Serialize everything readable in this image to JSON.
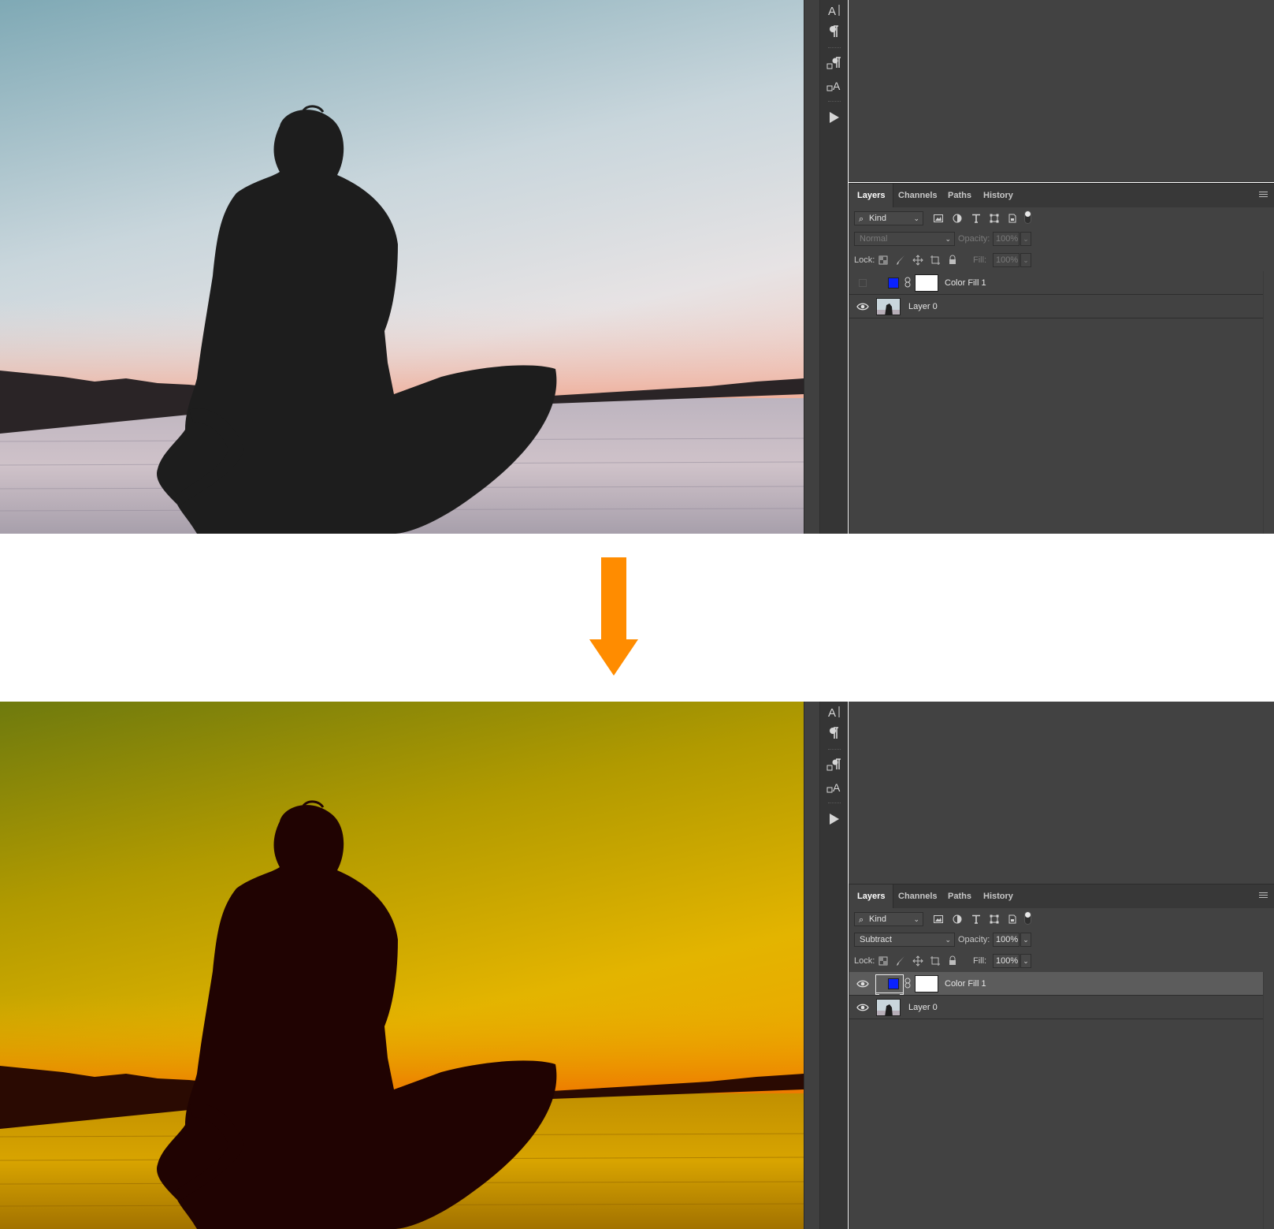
{
  "colors": {
    "arrow": "#ff8c00",
    "panel_bg": "#424242",
    "fill_swatch": "#0a22ff"
  },
  "icons": {
    "toolstrip": [
      "character-icon",
      "paragraph-icon",
      "paragraph-styles-icon",
      "character-styles-icon",
      "play-icon"
    ],
    "filters": [
      "image-filter-icon",
      "adjustment-filter-icon",
      "type-filter-icon",
      "shape-filter-icon",
      "smart-object-filter-icon"
    ],
    "locks": [
      "lock-transparent-icon",
      "lock-paint-icon",
      "lock-position-icon",
      "lock-artboard-icon",
      "lock-all-icon"
    ]
  },
  "before": {
    "tabs": [
      "Layers",
      "Channels",
      "Paths",
      "History"
    ],
    "active_tab": "Layers",
    "kind_filter": "Kind",
    "blend_mode": "Normal",
    "opacity_label": "Opacity:",
    "opacity_value": "100%",
    "lock_label": "Lock:",
    "fill_label": "Fill:",
    "fill_value": "100%",
    "layers": [
      {
        "name": "Color Fill 1",
        "visible": false,
        "selected": false
      },
      {
        "name": "Layer 0",
        "visible": true,
        "selected": false
      }
    ]
  },
  "after": {
    "tabs": [
      "Layers",
      "Channels",
      "Paths",
      "History"
    ],
    "active_tab": "Layers",
    "kind_filter": "Kind",
    "blend_mode": "Subtract",
    "opacity_label": "Opacity:",
    "opacity_value": "100%",
    "lock_label": "Lock:",
    "fill_label": "Fill:",
    "fill_value": "100%",
    "layers": [
      {
        "name": "Color Fill 1",
        "visible": true,
        "selected": true
      },
      {
        "name": "Layer 0",
        "visible": true,
        "selected": false
      }
    ]
  }
}
